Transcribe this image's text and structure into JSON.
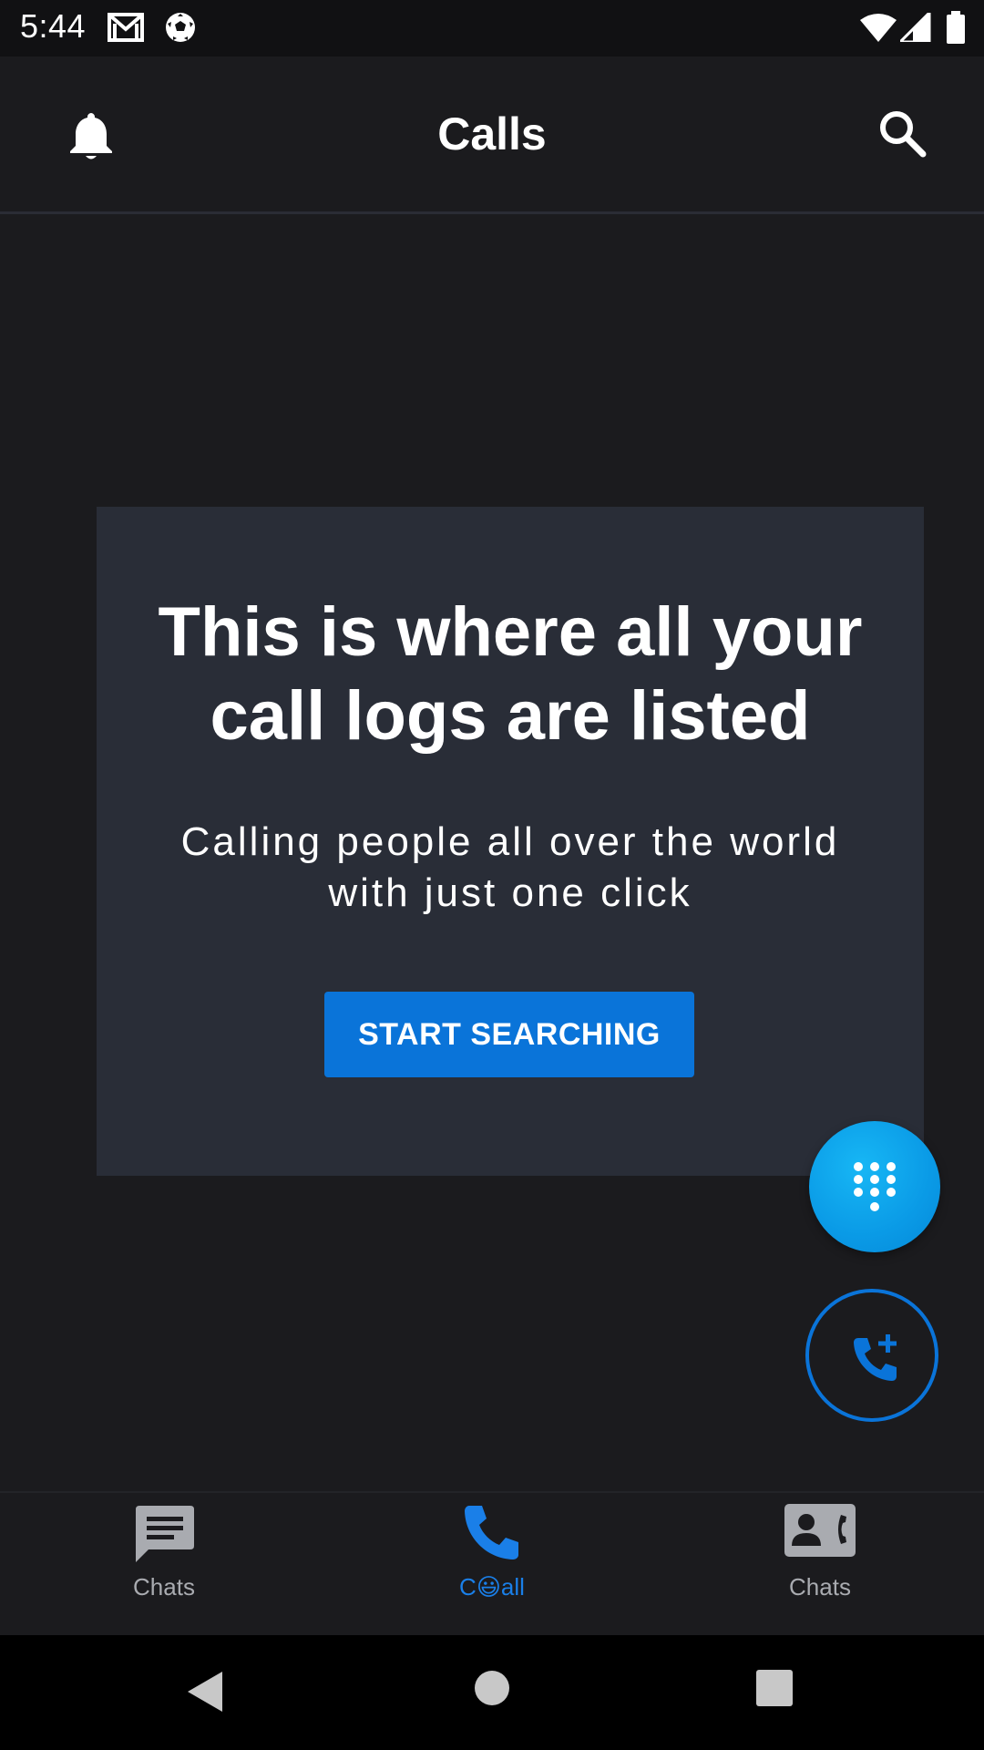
{
  "status_bar": {
    "time": "5:44",
    "icons": [
      "gmail-icon",
      "soccer-ball-icon",
      "wifi-icon",
      "signal-icon",
      "battery-icon"
    ]
  },
  "app_bar": {
    "title": "Calls",
    "left_icon": "bell-icon",
    "right_icon": "search-icon"
  },
  "empty_state": {
    "title_line1": "This is where all your",
    "title_line2": "call logs are listed",
    "subtitle_line1": "Calling people all over the world",
    "subtitle_line2": "with just one click",
    "button_label": "START SEARCHING"
  },
  "fabs": {
    "dialpad_icon": "dialpad-icon",
    "add_call_icon": "add-call-icon"
  },
  "bottom_nav": {
    "items": [
      {
        "label": "Chats",
        "icon": "chat-icon",
        "active": false
      },
      {
        "label": "C😃all",
        "icon": "phone-icon",
        "active": true
      },
      {
        "label": "Chats",
        "icon": "contacts-icon",
        "active": false
      }
    ]
  },
  "system_nav": {
    "icons": [
      "back-icon",
      "home-icon",
      "recents-icon"
    ]
  },
  "colors": {
    "background": "#1b1b1e",
    "card": "#292d37",
    "accent": "#0a74d9",
    "fab": "#0a9ae6",
    "inactive_nav": "#a9abb0",
    "active_nav": "#1a7fe8"
  }
}
